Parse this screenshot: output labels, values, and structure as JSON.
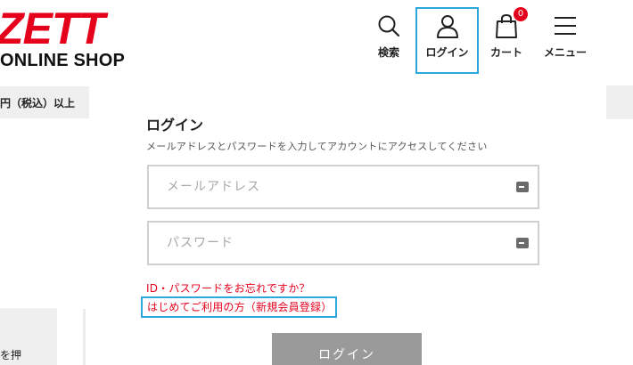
{
  "brand": {
    "logo_text": "ZETT",
    "subtitle": "ONLINE SHOP",
    "color": "#e5001c"
  },
  "header": {
    "nav": [
      {
        "id": "search",
        "label": "検索",
        "icon": "search-icon"
      },
      {
        "id": "login",
        "label": "ログイン",
        "icon": "user-icon"
      },
      {
        "id": "cart",
        "label": "カート",
        "icon": "shopping-bag-icon",
        "badge": "0"
      },
      {
        "id": "menu",
        "label": "メニュー",
        "icon": "hamburger-menu-icon"
      }
    ]
  },
  "promo": {
    "text": "円（税込）以上"
  },
  "side_fragment": {
    "text": "を押"
  },
  "login": {
    "title": "ログイン",
    "description": "メールアドレスとパスワードを入力してアカウントにアクセスしてください",
    "email_placeholder": "メールアドレス",
    "password_placeholder": "パスワード",
    "forgot_link": "ID・パスワードをお忘れですか？",
    "register_link": "はじめてご利用の方（新規会員登録）",
    "submit_label": "ログイン"
  },
  "colors": {
    "accent_red": "#e5001c",
    "highlight_blue": "#2aa7dd",
    "button_gray": "#9a9a9a"
  }
}
